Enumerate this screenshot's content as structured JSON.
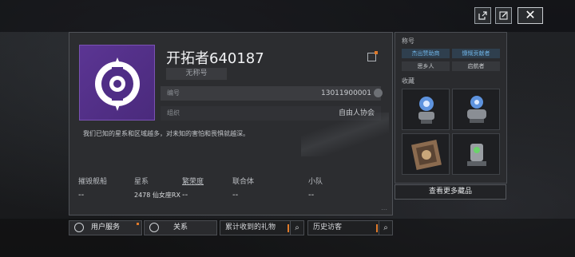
{
  "header": {
    "share_icon": "share-icon",
    "edit_icon": "edit-icon",
    "close_label": "✕"
  },
  "profile": {
    "name": "开拓者640187",
    "title": "无称号",
    "fields": [
      {
        "label": "编号",
        "value": "13011900001"
      },
      {
        "label": "组织",
        "value": "自由人协会"
      }
    ],
    "bio": "我们已知的星系和区域越多，对未知的害怕和畏惧就越深。",
    "stats": [
      {
        "label": "摧毁舰船",
        "value": "--"
      },
      {
        "label": "星系",
        "value": "2478 仙女座RX"
      },
      {
        "label": "繁荣度",
        "value": "--"
      },
      {
        "label": "联合体",
        "value": "--"
      },
      {
        "label": "小队",
        "value": "--"
      }
    ],
    "avatar_color": "#5b3593"
  },
  "actions": {
    "user_service": "用户服务",
    "relations": "关系",
    "gifts_received": "累计收到的礼物",
    "history_visitors": "历史访客"
  },
  "side": {
    "titles_header": "称号",
    "titles": [
      {
        "label": "杰出赞助商",
        "active": true
      },
      {
        "label": "慷慨贡献者",
        "active": true
      },
      {
        "label": "思乡人",
        "active": false
      },
      {
        "label": "启航者",
        "active": false
      }
    ],
    "collection_header": "收藏",
    "more_label": "查看更多藏品"
  },
  "colors": {
    "accent_orange": "#e07a2a",
    "title_blue": "#6fb4e6"
  }
}
